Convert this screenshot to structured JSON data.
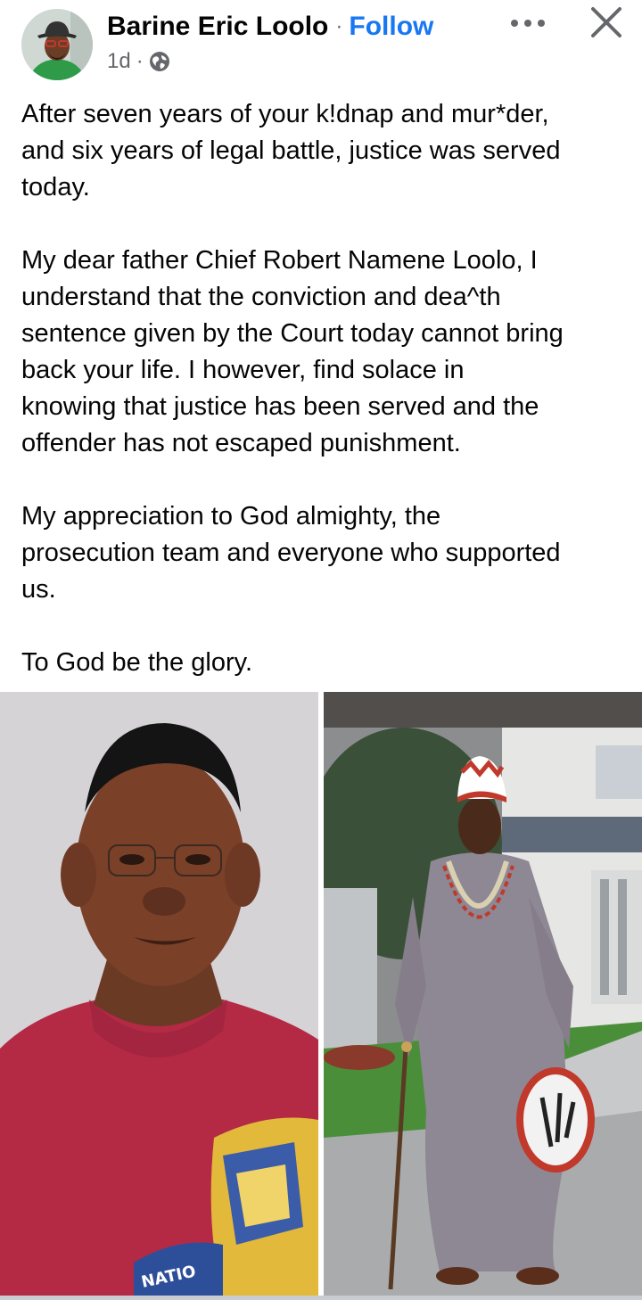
{
  "post": {
    "author": {
      "name": "Barine Eric Loolo",
      "separator": "·",
      "follow_label": "Follow",
      "avatar_icon": "profile-photo-icon"
    },
    "meta": {
      "time": "1d",
      "separator": "·",
      "audience_icon": "globe-icon"
    },
    "actions": {
      "more_icon": "more-options-icon",
      "close_icon": "close-icon"
    },
    "paragraphs": [
      "After seven years of your k!dnap and mur*der,\nand six years of legal battle, justice was served\ntoday.",
      "My dear father Chief Robert Namene Loolo, I\nunderstand that the conviction and dea^th\nsentence given by the Court today cannot bring\nback your life. I however, find solace in\nknowing that justice has been served and the\noffender has not escaped punishment.",
      "My appreciation to God almighty,  the\nprosecution team and everyone who supported\nus.",
      "To God be the glory."
    ],
    "photos": {
      "left": {
        "icon": "portrait-photo-icon",
        "badge_text": "NATIO"
      },
      "right": {
        "icon": "traditional-attire-photo-icon"
      }
    }
  },
  "colors": {
    "text": "#050505",
    "secondary_text": "#65676b",
    "follow_blue": "#1877f2",
    "background": "#ffffff"
  }
}
